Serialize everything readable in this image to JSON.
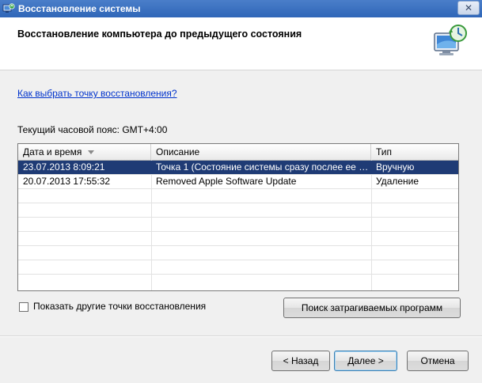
{
  "window": {
    "title": "Восстановление системы",
    "close_glyph": "✕"
  },
  "header": {
    "title": "Восстановление компьютера до предыдущего состояния",
    "icon": "system-restore-icon"
  },
  "help_link": "Как выбрать точку восстановления?",
  "timezone_label": "Текущий часовой пояс: GMT+4:00",
  "table": {
    "columns": [
      "Дата и время",
      "Описание",
      "Тип"
    ],
    "rows": [
      {
        "date": "23.07.2013 8:09:21",
        "description": "Точка 1 (Состояние системы сразу послее ее …",
        "type": "Вручную",
        "selected": true
      },
      {
        "date": "20.07.2013 17:55:32",
        "description": "Removed Apple Software Update",
        "type": "Удаление",
        "selected": false
      }
    ]
  },
  "show_more": {
    "label": "Показать другие точки восстановления",
    "checked": false
  },
  "buttons": {
    "scan": "Поиск затрагиваемых программ",
    "back": "< Назад",
    "next": "Далее >",
    "cancel": "Отмена"
  },
  "colors": {
    "selected_row": "#1f3b75",
    "link": "#0033cc",
    "titlebar": "#2f66b8"
  }
}
